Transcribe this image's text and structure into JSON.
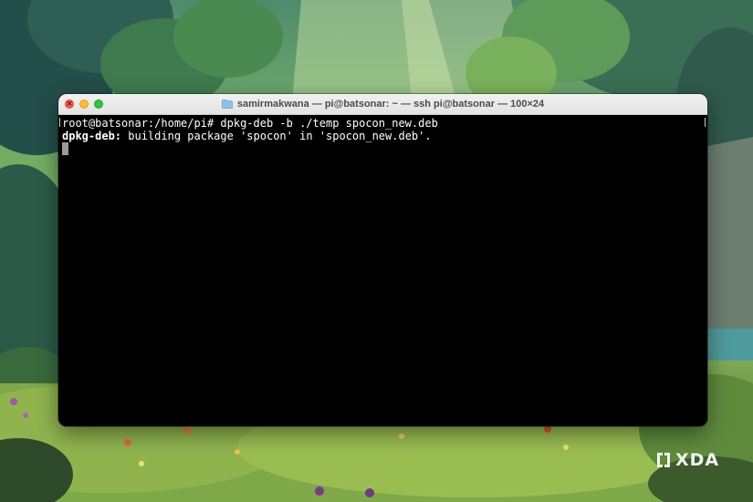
{
  "window": {
    "title": "samirmakwana — pi@batsonar: ~ — ssh pi@batsonar — 100×24",
    "title_icon": "folder-icon",
    "buttons": [
      "close-button",
      "minimize-button",
      "zoom-button"
    ]
  },
  "terminal": {
    "line1": "root@batsonar:/home/pi# dpkg-deb -b ./temp spocon_new.deb",
    "line2_prefix": "dpkg-deb:",
    "line2_rest": " building package 'spocon' in 'spocon_new.deb'."
  },
  "watermark": {
    "text": "XDA",
    "icon": "xda-logo-icon"
  },
  "colors": {
    "close": "#fe5f57",
    "minimize": "#febc2e",
    "zoom": "#28c840",
    "terminal_bg": "#000000",
    "terminal_text": "#ffffff"
  }
}
